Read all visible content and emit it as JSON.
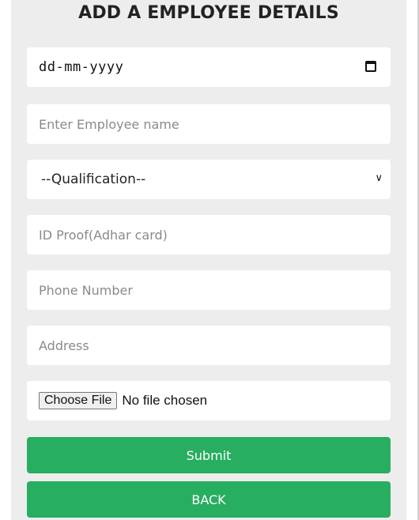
{
  "form": {
    "title": "ADD A EMPLOYEE DETAILS",
    "date_placeholder": "dd-mm-yyyy",
    "name_placeholder": "Enter Employee name",
    "qualification_selected": "--Qualification--",
    "id_proof_placeholder": "ID Proof(Adhar card)",
    "phone_placeholder": "Phone Number",
    "address_placeholder": "Address",
    "file_button_label": "Choose File",
    "file_status": "No file chosen",
    "submit_label": "Submit",
    "back_label": "BACK"
  },
  "icons": {
    "date": "calendar-icon",
    "select": "chevron-down-icon"
  },
  "colors": {
    "panel_bg": "#ededed",
    "button_bg": "#27ae60",
    "button_text": "#ffffff"
  }
}
